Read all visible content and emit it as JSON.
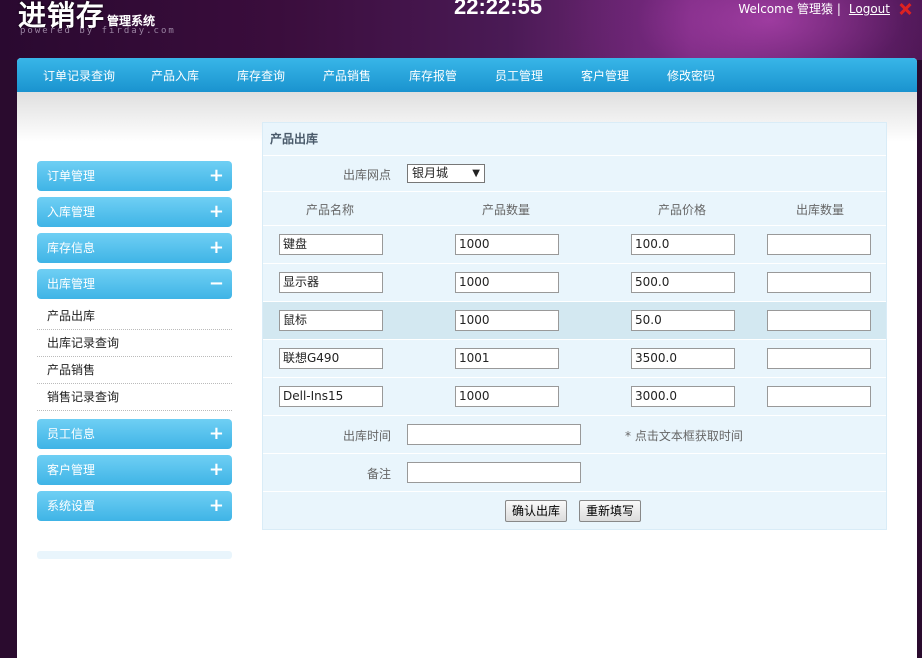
{
  "header": {
    "logo_main": "进销存",
    "logo_sub": "管理系统",
    "powered": "powered by firday.com",
    "clock": "22:22:55",
    "welcome": "Welcome 管理猿 |",
    "logout": "Logout"
  },
  "topnav": [
    "订单记录查询",
    "产品入库",
    "库存查询",
    "产品销售",
    "库存报管",
    "员工管理",
    "客户管理",
    "修改密码"
  ],
  "sidebar": {
    "sections": [
      {
        "label": "订单管理",
        "sign": "+"
      },
      {
        "label": "入库管理",
        "sign": "+"
      },
      {
        "label": "库存信息",
        "sign": "+"
      },
      {
        "label": "出库管理",
        "sign": "−"
      }
    ],
    "sub_items": [
      "产品出库",
      "出库记录查询",
      "产品销售",
      "销售记录查询"
    ],
    "sections_after": [
      {
        "label": "员工信息",
        "sign": "+"
      },
      {
        "label": "客户管理",
        "sign": "+"
      },
      {
        "label": "系统设置",
        "sign": "+"
      }
    ]
  },
  "form": {
    "title": "产品出库",
    "outlet_label": "出库网点",
    "outlet_value": "银月城",
    "columns": [
      "产品名称",
      "产品数量",
      "产品价格",
      "出库数量"
    ],
    "rows": [
      {
        "name": "键盘",
        "qty": "1000",
        "price": "100.0",
        "out": ""
      },
      {
        "name": "显示器",
        "qty": "1000",
        "price": "500.0",
        "out": ""
      },
      {
        "name": "鼠标",
        "qty": "1000",
        "price": "50.0",
        "out": ""
      },
      {
        "name": "联想G490",
        "qty": "1001",
        "price": "3500.0",
        "out": ""
      },
      {
        "name": "Dell-Ins15",
        "qty": "1000",
        "price": "3000.0",
        "out": ""
      }
    ],
    "time_label": "出库时间",
    "time_hint": "* 点击文本框获取时间",
    "note_label": "备注",
    "confirm_btn": "确认出库",
    "reset_btn": "重新填写"
  }
}
